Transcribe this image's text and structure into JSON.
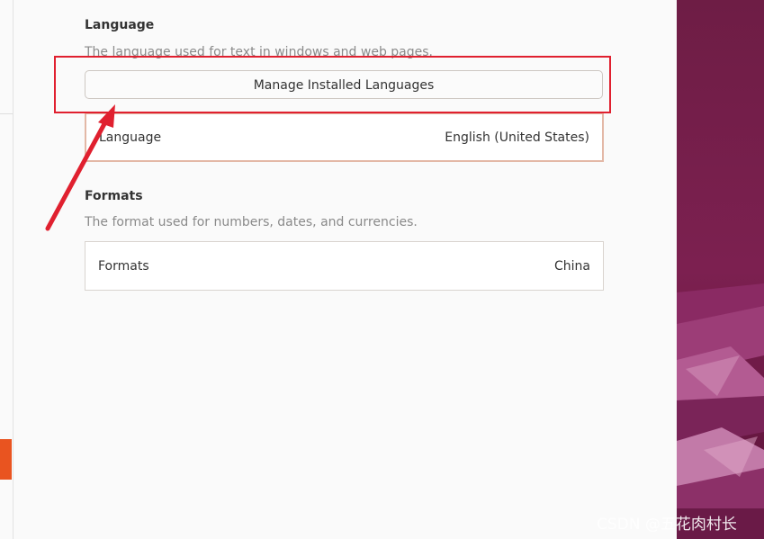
{
  "language_section": {
    "title": "Language",
    "description": "The language used for text in windows and web pages.",
    "manage_button_label": "Manage Installed Languages",
    "row_label": "Language",
    "row_value": "English (United States)"
  },
  "formats_section": {
    "title": "Formats",
    "description": "The format used for numbers, dates, and currencies.",
    "row_label": "Formats",
    "row_value": "China"
  },
  "annotation": {
    "highlight_color": "#e0202f"
  },
  "watermark": "CSDN @五花肉村长",
  "colors": {
    "accent": "#e95420",
    "wallpaper": "#7a1f4e"
  }
}
